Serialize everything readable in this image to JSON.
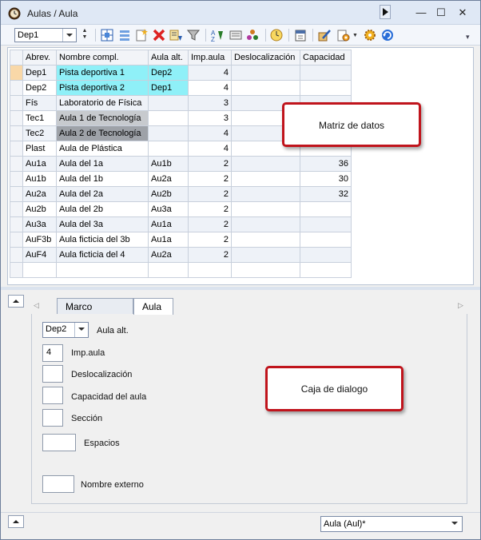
{
  "window": {
    "title": "Aulas / Aula"
  },
  "title_buttons": {
    "minimize": "—",
    "maximize": "☐",
    "close": "✕"
  },
  "toolbar": {
    "selector_value": "Dep1",
    "tools": [
      "grid-add-icon",
      "columns-icon",
      "new-record-icon",
      "delete-icon",
      "sort-icon",
      "filter-icon",
      "sort-alpha-icon",
      "fields-icon",
      "relations-icon",
      "clock-icon",
      "calendar-icon",
      "edit-icon",
      "settings-icon",
      "gear-icon",
      "refresh-icon"
    ]
  },
  "grid": {
    "headers": [
      "Abrev.",
      "Nombre compl.",
      "Aula alt.",
      "Imp.aula",
      "Deslocalización",
      "Capacidad"
    ],
    "rows": [
      {
        "abrev": "Dep1",
        "nombre": "Pista deportiva 1",
        "aula_alt": "Dep2",
        "imp": "4",
        "desloc": "",
        "cap": ""
      },
      {
        "abrev": "Dep2",
        "nombre": "Pista deportiva 2",
        "aula_alt": "Dep1",
        "imp": "4",
        "desloc": "",
        "cap": ""
      },
      {
        "abrev": "Fís",
        "nombre": "Laboratorio de Física",
        "aula_alt": "",
        "imp": "3",
        "desloc": "",
        "cap": ""
      },
      {
        "abrev": "Tec1",
        "nombre": "Aula 1 de Tecnología",
        "aula_alt": "",
        "imp": "3",
        "desloc": "",
        "cap": ""
      },
      {
        "abrev": "Tec2",
        "nombre": "Aula 2 de Tecnología",
        "aula_alt": "",
        "imp": "4",
        "desloc": "",
        "cap": ""
      },
      {
        "abrev": "Plast",
        "nombre": "Aula de Plástica",
        "aula_alt": "",
        "imp": "4",
        "desloc": "",
        "cap": ""
      },
      {
        "abrev": "Au1a",
        "nombre": "Aula del 1a",
        "aula_alt": "Au1b",
        "imp": "2",
        "desloc": "",
        "cap": "36"
      },
      {
        "abrev": "Au1b",
        "nombre": "Aula del 1b",
        "aula_alt": "Au2a",
        "imp": "2",
        "desloc": "",
        "cap": "30"
      },
      {
        "abrev": "Au2a",
        "nombre": "Aula del 2a",
        "aula_alt": "Au2b",
        "imp": "2",
        "desloc": "",
        "cap": "32"
      },
      {
        "abrev": "Au2b",
        "nombre": "Aula del 2b",
        "aula_alt": "Au3a",
        "imp": "2",
        "desloc": "",
        "cap": ""
      },
      {
        "abrev": "Au3a",
        "nombre": "Aula del 3a",
        "aula_alt": "Au1a",
        "imp": "2",
        "desloc": "",
        "cap": ""
      },
      {
        "abrev": "AuF3b",
        "nombre": "Aula ficticia del 3b",
        "aula_alt": "Au1a",
        "imp": "2",
        "desloc": "",
        "cap": ""
      },
      {
        "abrev": "AuF4",
        "nombre": "Aula ficticia del 4",
        "aula_alt": "Au2a",
        "imp": "2",
        "desloc": "",
        "cap": ""
      },
      {
        "abrev": "",
        "nombre": "",
        "aula_alt": "",
        "imp": "",
        "desloc": "",
        "cap": ""
      }
    ],
    "row_highlights": {
      "0": "cyan",
      "1": "cyan",
      "3": "lgray",
      "4": "dgray"
    }
  },
  "callouts": {
    "data_matrix": "Matriz de datos",
    "dialog_box": "Caja de dialogo"
  },
  "tabs": [
    {
      "label": "Marco horario",
      "active": false
    },
    {
      "label": "Aula",
      "active": true
    }
  ],
  "dialog": {
    "aula_alt_value": "Dep2",
    "aula_alt_label": "Aula alt.",
    "imp_value": "4",
    "imp_label": "Imp.aula",
    "desloc_label": "Deslocalización",
    "capacidad_label": "Capacidad del aula",
    "seccion_label": "Sección",
    "espacios_label": "Espacios",
    "nombre_externo_label": "Nombre externo"
  },
  "status": {
    "view_selector": "Aula (Aul)*"
  },
  "colors": {
    "callout_border": "#c0141c",
    "cyan_highlight": "#8ff0f8",
    "selected_row": "#f9d8a8"
  }
}
